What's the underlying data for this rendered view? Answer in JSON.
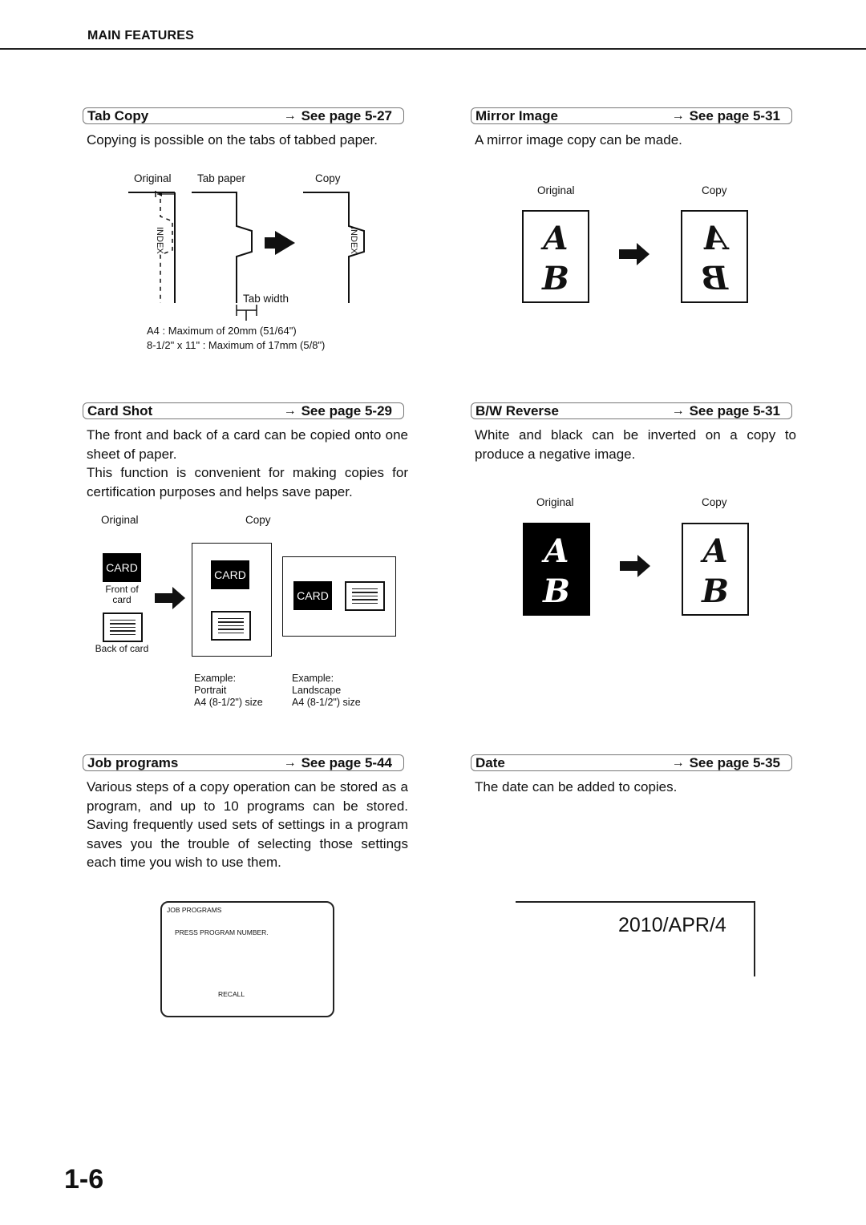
{
  "header": {
    "title": "MAIN FEATURES"
  },
  "see_page_prefix": "See page",
  "arrow_glyph": "→",
  "sections": {
    "tab_copy": {
      "title": "Tab Copy",
      "ref": "See page 5-27",
      "text": "Copying is possible on the tabs of tabbed paper.",
      "figure": {
        "label_original": "Original",
        "label_tab_paper": "Tab paper",
        "label_copy": "Copy",
        "index_text": "INDEX",
        "tab_width_label": "Tab width",
        "note_a4": "A4 : Maximum of 20mm (51/64\")",
        "note_letter": "8-1/2\" x 11\" : Maximum of 17mm (5/8\")"
      }
    },
    "mirror_image": {
      "title": "Mirror Image",
      "ref": "See page 5-31",
      "text": "A mirror image copy can be made.",
      "figure": {
        "label_original": "Original",
        "label_copy": "Copy",
        "letter_a": "A",
        "letter_b": "B"
      }
    },
    "card_shot": {
      "title": "Card Shot",
      "ref": "See page 5-29",
      "text_1": "The front and back of a card can be copied onto one sheet of paper.",
      "text_2": "This function is convenient for making copies for certification purposes and helps save paper.",
      "figure": {
        "label_original": "Original",
        "label_copy": "Copy",
        "card_text": "CARD",
        "front_label": "Front of card",
        "back_label": "Back of card",
        "example_portrait": [
          "Example:",
          "Portrait",
          "A4 (8-1/2\") size"
        ],
        "example_landscape": [
          "Example:",
          "Landscape",
          "A4 (8-1/2\") size"
        ]
      }
    },
    "bw_reverse": {
      "title": "B/W Reverse",
      "ref": "See page 5-31",
      "text": "White and black can be inverted on a copy to produce a negative image.",
      "figure": {
        "label_original": "Original",
        "label_copy": "Copy",
        "letter_a": "A",
        "letter_b": "B"
      }
    },
    "job_programs": {
      "title": "Job programs",
      "ref": "See page 5-44",
      "text": "Various steps of a copy operation can be stored as a program, and up to 10 programs can be stored. Saving frequently used sets of settings in a program saves you the trouble of selecting those settings each time you wish to use them.",
      "screen": {
        "title": "JOB PROGRAMS",
        "message": "PRESS PROGRAM NUMBER.",
        "button": "RECALL"
      }
    },
    "date": {
      "title": "Date",
      "ref": "See page 5-35",
      "text": "The date can be added to copies.",
      "sample_date": "2010/APR/4"
    }
  },
  "page_number": "1-6"
}
